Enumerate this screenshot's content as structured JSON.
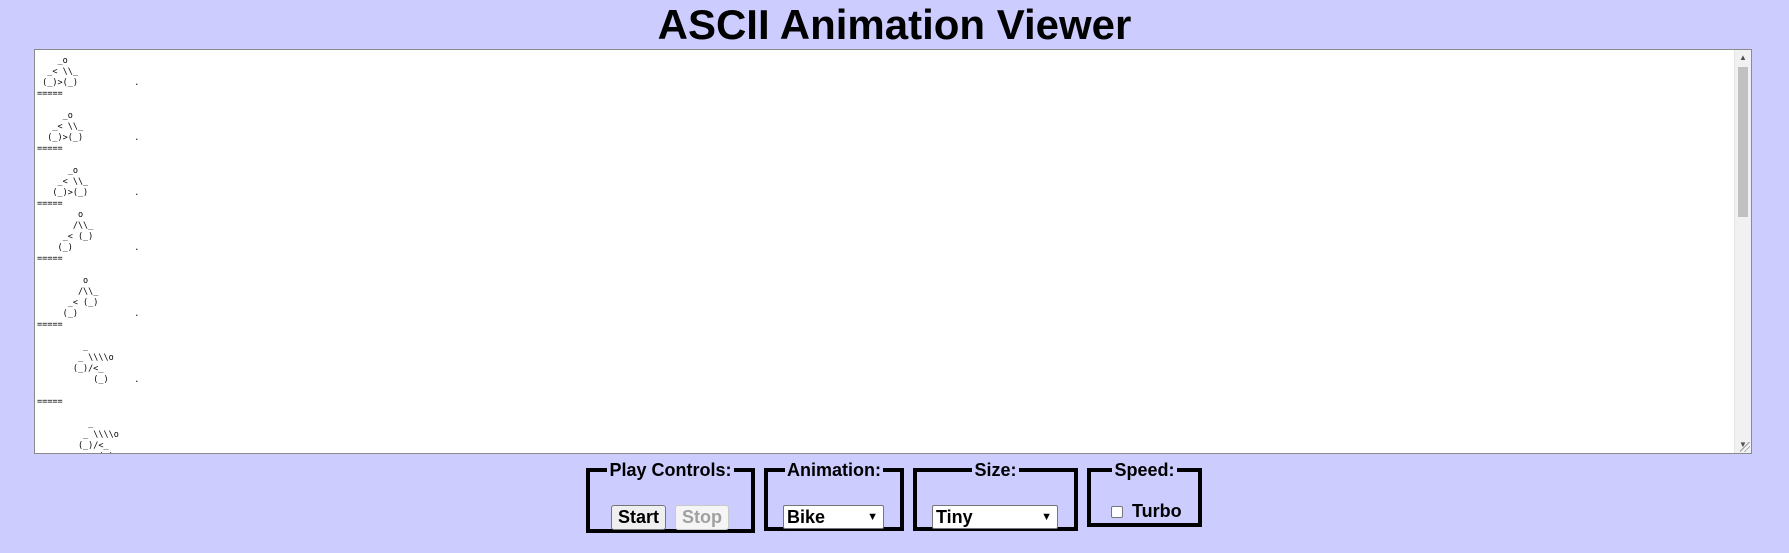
{
  "page": {
    "title": "ASCII Animation Viewer"
  },
  "animation_area": {
    "frames_text": "    _o\n  _< \\\\_\n (_)>(_)           .\n=====\n\n     _o\n   _< \\\\_\n  (_)>(_)          .\n=====\n\n      _o\n    _< \\\\_\n   (_)>(_)         .\n=====\n        o\n       /\\\\_\n     _< (_)\n    (_)            .\n=====\n\n         o\n        /\\\\_\n      _< (_)\n     (_)           .\n=====\n\n         _\n        _ \\\\\\\\o\n       (_)/<_\n           (_)     .\n\n=====\n\n          _\n         _ \\\\\\\\o\n        (_)/<_\n            (_).\n====="
  },
  "controls": {
    "play": {
      "legend": "Play Controls:",
      "start_label": "Start",
      "stop_label": "Stop"
    },
    "animation": {
      "legend": "Animation:",
      "selected": "Bike"
    },
    "size": {
      "legend": "Size:",
      "selected": "Tiny"
    },
    "speed": {
      "legend": "Speed:",
      "turbo_label": "Turbo",
      "turbo_checked": false
    }
  },
  "icons": {
    "scroll_up": "triangle-up-icon",
    "scroll_down": "triangle-down-icon",
    "select_arrow": "chevron-down-icon",
    "resize": "resize-grip-icon"
  },
  "colors": {
    "background": "#ccccff",
    "text_area_background": "#ffffff",
    "border": "#000000"
  }
}
